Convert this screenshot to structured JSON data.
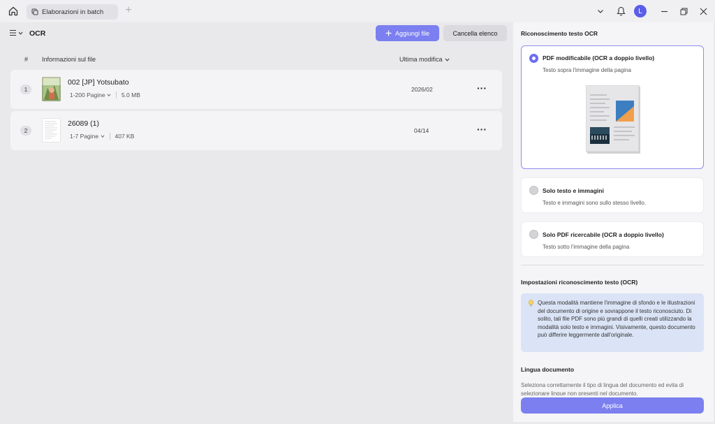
{
  "titlebar": {
    "tab_label": "Elaborazioni in batch",
    "avatar_initial": "L"
  },
  "toolbar": {
    "title": "OCR",
    "add_label": "Aggiungi file",
    "clear_label": "Cancella elenco"
  },
  "table": {
    "col_num": "#",
    "col_info": "Informazioni sul file",
    "col_modified": "Ultima modifica",
    "rows": [
      {
        "num": "1",
        "name": "002 [JP] Yotsubato",
        "pages": "1-200 Pagine",
        "size": "5.0 MB",
        "date": "2026/02"
      },
      {
        "num": "2",
        "name": "26089 (1)",
        "pages": "1-7 Pagine",
        "size": "407 KB",
        "date": "04/14"
      }
    ]
  },
  "panel": {
    "ocr_title": "Riconoscimento testo OCR",
    "options": [
      {
        "title": "PDF modificabile (OCR a doppio livello)",
        "desc": "Testo sopra l'immagine della pagina",
        "selected": true
      },
      {
        "title": "Solo testo e immagini",
        "desc": "Testo e immagini sono sullo stesso livello.",
        "selected": false
      },
      {
        "title": "Solo PDF ricercabile (OCR a doppio livello)",
        "desc": "Testo sotto l'immagine della pagina",
        "selected": false
      }
    ],
    "settings_title": "Impostazioni riconoscimento testo (OCR)",
    "info_text": "Questa modalità mantiene l'immagine di sfondo e le illustrazioni del documento di origine e sovrappone il testo riconosciuto. Di solito, tali file PDF sono più grandi di quelli creati utilizzando la modalità solo testo e immagini. Visivamente, questo documento può differire leggermente dall'originale.",
    "lang_title": "Lingua documento",
    "lang_desc": "Seleziona correttamente il tipo di lingua del documento ed evita di selezionare lingue non presenti nel documento.",
    "apply_label": "Applica"
  },
  "colors": {
    "accent": "#7b7ff0",
    "selected_border": "#8b8ef3",
    "info_bg": "#dbe4f6"
  }
}
